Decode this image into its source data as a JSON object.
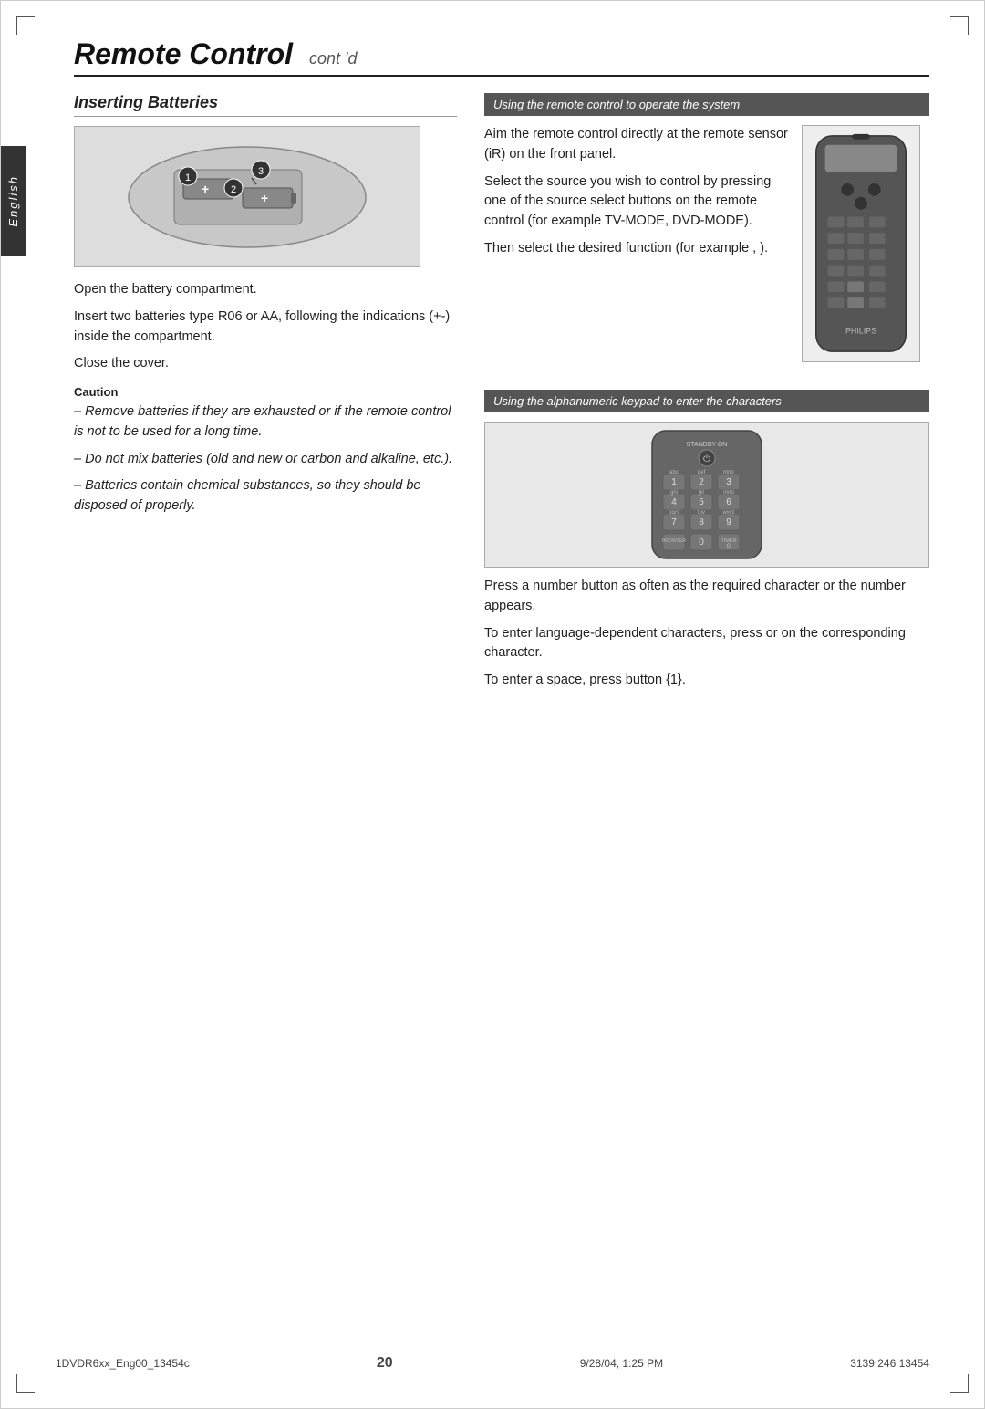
{
  "page": {
    "title": "Remote Control",
    "title_sub": "cont 'd",
    "page_number": "20",
    "footer_left": "1DVDR6xx_Eng00_13454c",
    "footer_center": "20",
    "footer_right": "3139 246 13454",
    "footer_date": "9/28/04, 1:25 PM"
  },
  "side_tab": {
    "text": "English"
  },
  "left_section": {
    "title": "Inserting Batteries",
    "para1": "Open the battery compartment.",
    "para2": "Insert two batteries type R06 or AA, following the indications (+-) inside the compartment.",
    "para3": "Close the cover.",
    "caution_label": "Caution",
    "caution_items": [
      "– Remove batteries if they are exhausted or if the remote control is not to be used for a long time.",
      "– Do not mix batteries (old and new or carbon and alkaline, etc.).",
      "– Batteries contain chemical substances, so they should be disposed of properly."
    ]
  },
  "right_section": {
    "section1_header": "Using the remote control to operate the system",
    "section1_para1": "Aim the remote control directly at the remote sensor (iR) on the front panel.",
    "section1_para2": "Select the source you wish to control by pressing one of the source select buttons on the remote control (for example TV-MODE, DVD-MODE).",
    "section1_para3": "Then select the desired function (for example         ,        ).",
    "section2_header": "Using the alphanumeric keypad to enter the characters",
    "section2_para1": "Press a number button as often as the required character or the number appears.",
    "section2_para2": "To enter language-dependent characters, press    or    on the corresponding character.",
    "section2_para3": "To enter a space, press button {1}."
  }
}
